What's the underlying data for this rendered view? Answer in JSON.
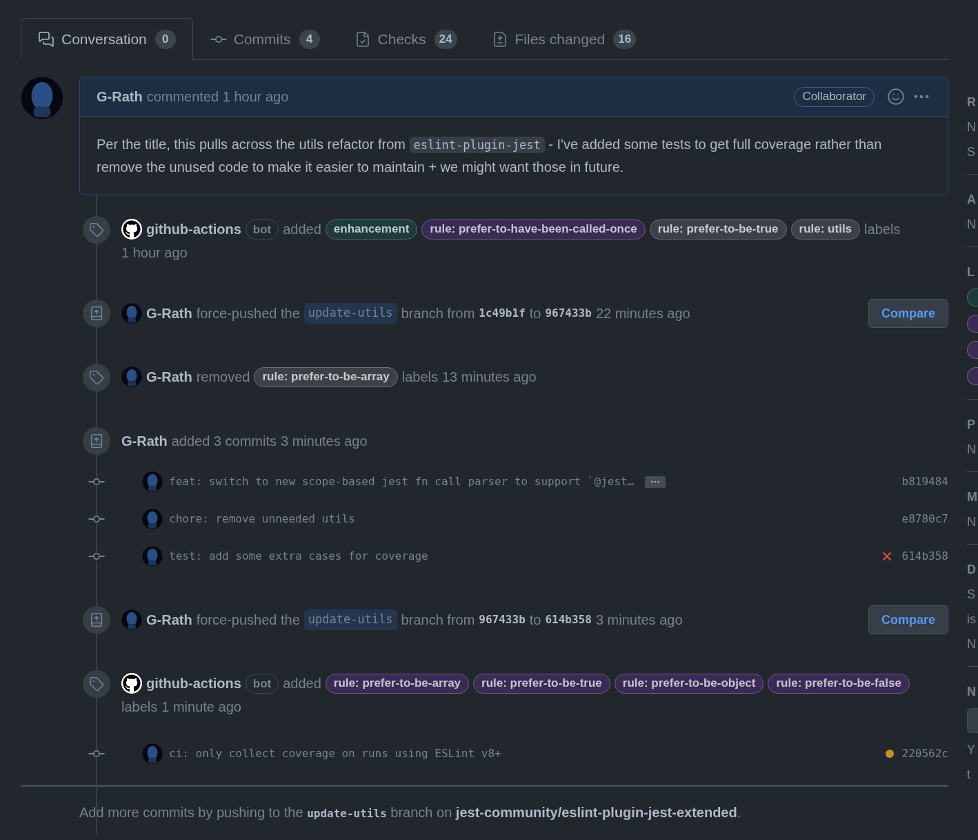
{
  "tabs": [
    {
      "label": "Conversation",
      "count": "0",
      "selected": true
    },
    {
      "label": "Commits",
      "count": "4",
      "selected": false
    },
    {
      "label": "Checks",
      "count": "24",
      "selected": false
    },
    {
      "label": "Files changed",
      "count": "16",
      "selected": false
    }
  ],
  "comment": {
    "author": "G-Rath",
    "action": "commented",
    "time": "1 hour ago",
    "badge": "Collaborator",
    "body_1": "Per the title, this pulls across the utils refactor from",
    "code": "eslint-plugin-jest",
    "body_2": "- I've added some tests to get full coverage rather than remove the unused code to make it easier to maintain + we might want those in future."
  },
  "events": [
    {
      "kind": "labels",
      "actor": "github-actions",
      "bot": "bot",
      "verb": "added",
      "labels": [
        {
          "name": "enhancement",
          "color": "#1d3b3b"
        },
        {
          "name": "rule: prefer-to-have-been-called-once",
          "color": "#3a2b55"
        },
        {
          "name": "rule: prefer-to-be-true",
          "color": "#3d4147"
        },
        {
          "name": "rule: utils",
          "color": "#3d4147"
        }
      ],
      "suffix": "labels",
      "time": "1 hour ago"
    },
    {
      "kind": "force_push",
      "actor": "G-Rath",
      "text_1": "force-pushed the",
      "branch": "update-utils",
      "text_2": "branch from",
      "from": "1c49b1f",
      "text_3": "to",
      "to": "967433b",
      "time": "22 minutes ago",
      "button": "Compare"
    },
    {
      "kind": "labels",
      "actor": "G-Rath",
      "verb": "removed",
      "labels": [
        {
          "name": "rule: prefer-to-be-array",
          "color": "#3d4147"
        }
      ],
      "suffix": "labels",
      "time": "13 minutes ago"
    },
    {
      "kind": "commits",
      "actor": "G-Rath",
      "text": "added 3 commits",
      "time": "3 minutes ago"
    },
    {
      "kind": "commit",
      "message": "feat: switch to new scope-based jest fn call parser to support `@jest…",
      "sha": "b819484",
      "expandable": true,
      "failed": false,
      "pending": false
    },
    {
      "kind": "commit",
      "message": "chore: remove unneeded utils",
      "sha": "e8780c7",
      "expandable": false,
      "failed": false,
      "pending": false
    },
    {
      "kind": "commit",
      "message": "test: add some extra cases for coverage",
      "sha": "614b358",
      "expandable": false,
      "failed": true,
      "pending": false
    },
    {
      "kind": "force_push",
      "actor": "G-Rath",
      "text_1": "force-pushed the",
      "branch": "update-utils",
      "text_2": "branch from",
      "from": "967433b",
      "text_3": "to",
      "to": "614b358",
      "time": "3 minutes ago",
      "button": "Compare"
    },
    {
      "kind": "labels",
      "actor": "github-actions",
      "bot": "bot",
      "verb": "added",
      "labels": [
        {
          "name": "rule: prefer-to-be-array",
          "color": "#3a2b55"
        },
        {
          "name": "rule: prefer-to-be-true",
          "color": "#3a2b55"
        },
        {
          "name": "rule: prefer-to-be-object",
          "color": "#3a2b55"
        },
        {
          "name": "rule: prefer-to-be-false",
          "color": "#3a2b55"
        }
      ],
      "suffix": "labels",
      "time": "1 minute ago"
    },
    {
      "kind": "commit",
      "message": "ci: only collect coverage on runs using ESLint v8+",
      "sha": "220562c",
      "expandable": false,
      "failed": false,
      "pending": true
    }
  ],
  "footer": {
    "text_1": "Add more commits by pushing to the",
    "branch": "update-utils",
    "text_2": "branch on",
    "repo": "jest-community/eslint-plugin-jest-extended",
    "text_3": "."
  },
  "sidebar": {
    "sections": [
      {
        "heading": "R",
        "lines": [
          "N",
          "S"
        ]
      },
      {
        "heading": "A",
        "lines": [
          "N"
        ]
      },
      {
        "heading": "L",
        "labels": [
          {
            "color": "#1d3b3b"
          },
          {
            "color": "#3a2b55"
          },
          {
            "color": "#3a2b55"
          },
          {
            "color": "#3a2b55"
          }
        ]
      },
      {
        "heading": "P",
        "lines": [
          "N"
        ]
      },
      {
        "heading": "M",
        "lines": [
          "N"
        ]
      },
      {
        "heading": "D",
        "lines": [
          "S",
          "is",
          "N"
        ]
      },
      {
        "heading": "N",
        "button": true,
        "lines": [
          "Y",
          "t"
        ]
      }
    ]
  }
}
